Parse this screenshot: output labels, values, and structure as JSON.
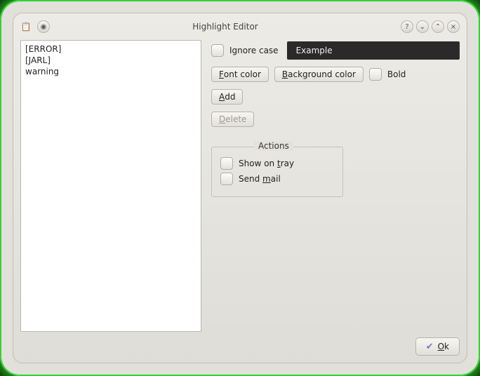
{
  "window": {
    "title": "Highlight Editor"
  },
  "list": {
    "items": [
      "[ERROR]",
      "[JARL]",
      "warning"
    ]
  },
  "controls": {
    "ignore_case_label": "Ignore case",
    "example_text": "Example",
    "font_color_prefix": "F",
    "font_color_rest": "ont color",
    "bg_color_prefix": "B",
    "bg_color_rest": "ackground color",
    "bold_label": "Bold",
    "add_prefix": "A",
    "add_rest": "dd",
    "delete_prefix": "D",
    "delete_rest": "elete"
  },
  "actions": {
    "group_title": "Actions",
    "show_tray_pre": "Show on ",
    "show_tray_u": "t",
    "show_tray_post": "ray",
    "send_mail_pre": "Send ",
    "send_mail_u": "m",
    "send_mail_post": "ail"
  },
  "footer": {
    "ok_prefix": "O",
    "ok_rest": "k"
  },
  "titlebar_icons": {
    "help": "?",
    "down": "⌄",
    "up": "⌃",
    "close": "×",
    "pin": "◉"
  }
}
